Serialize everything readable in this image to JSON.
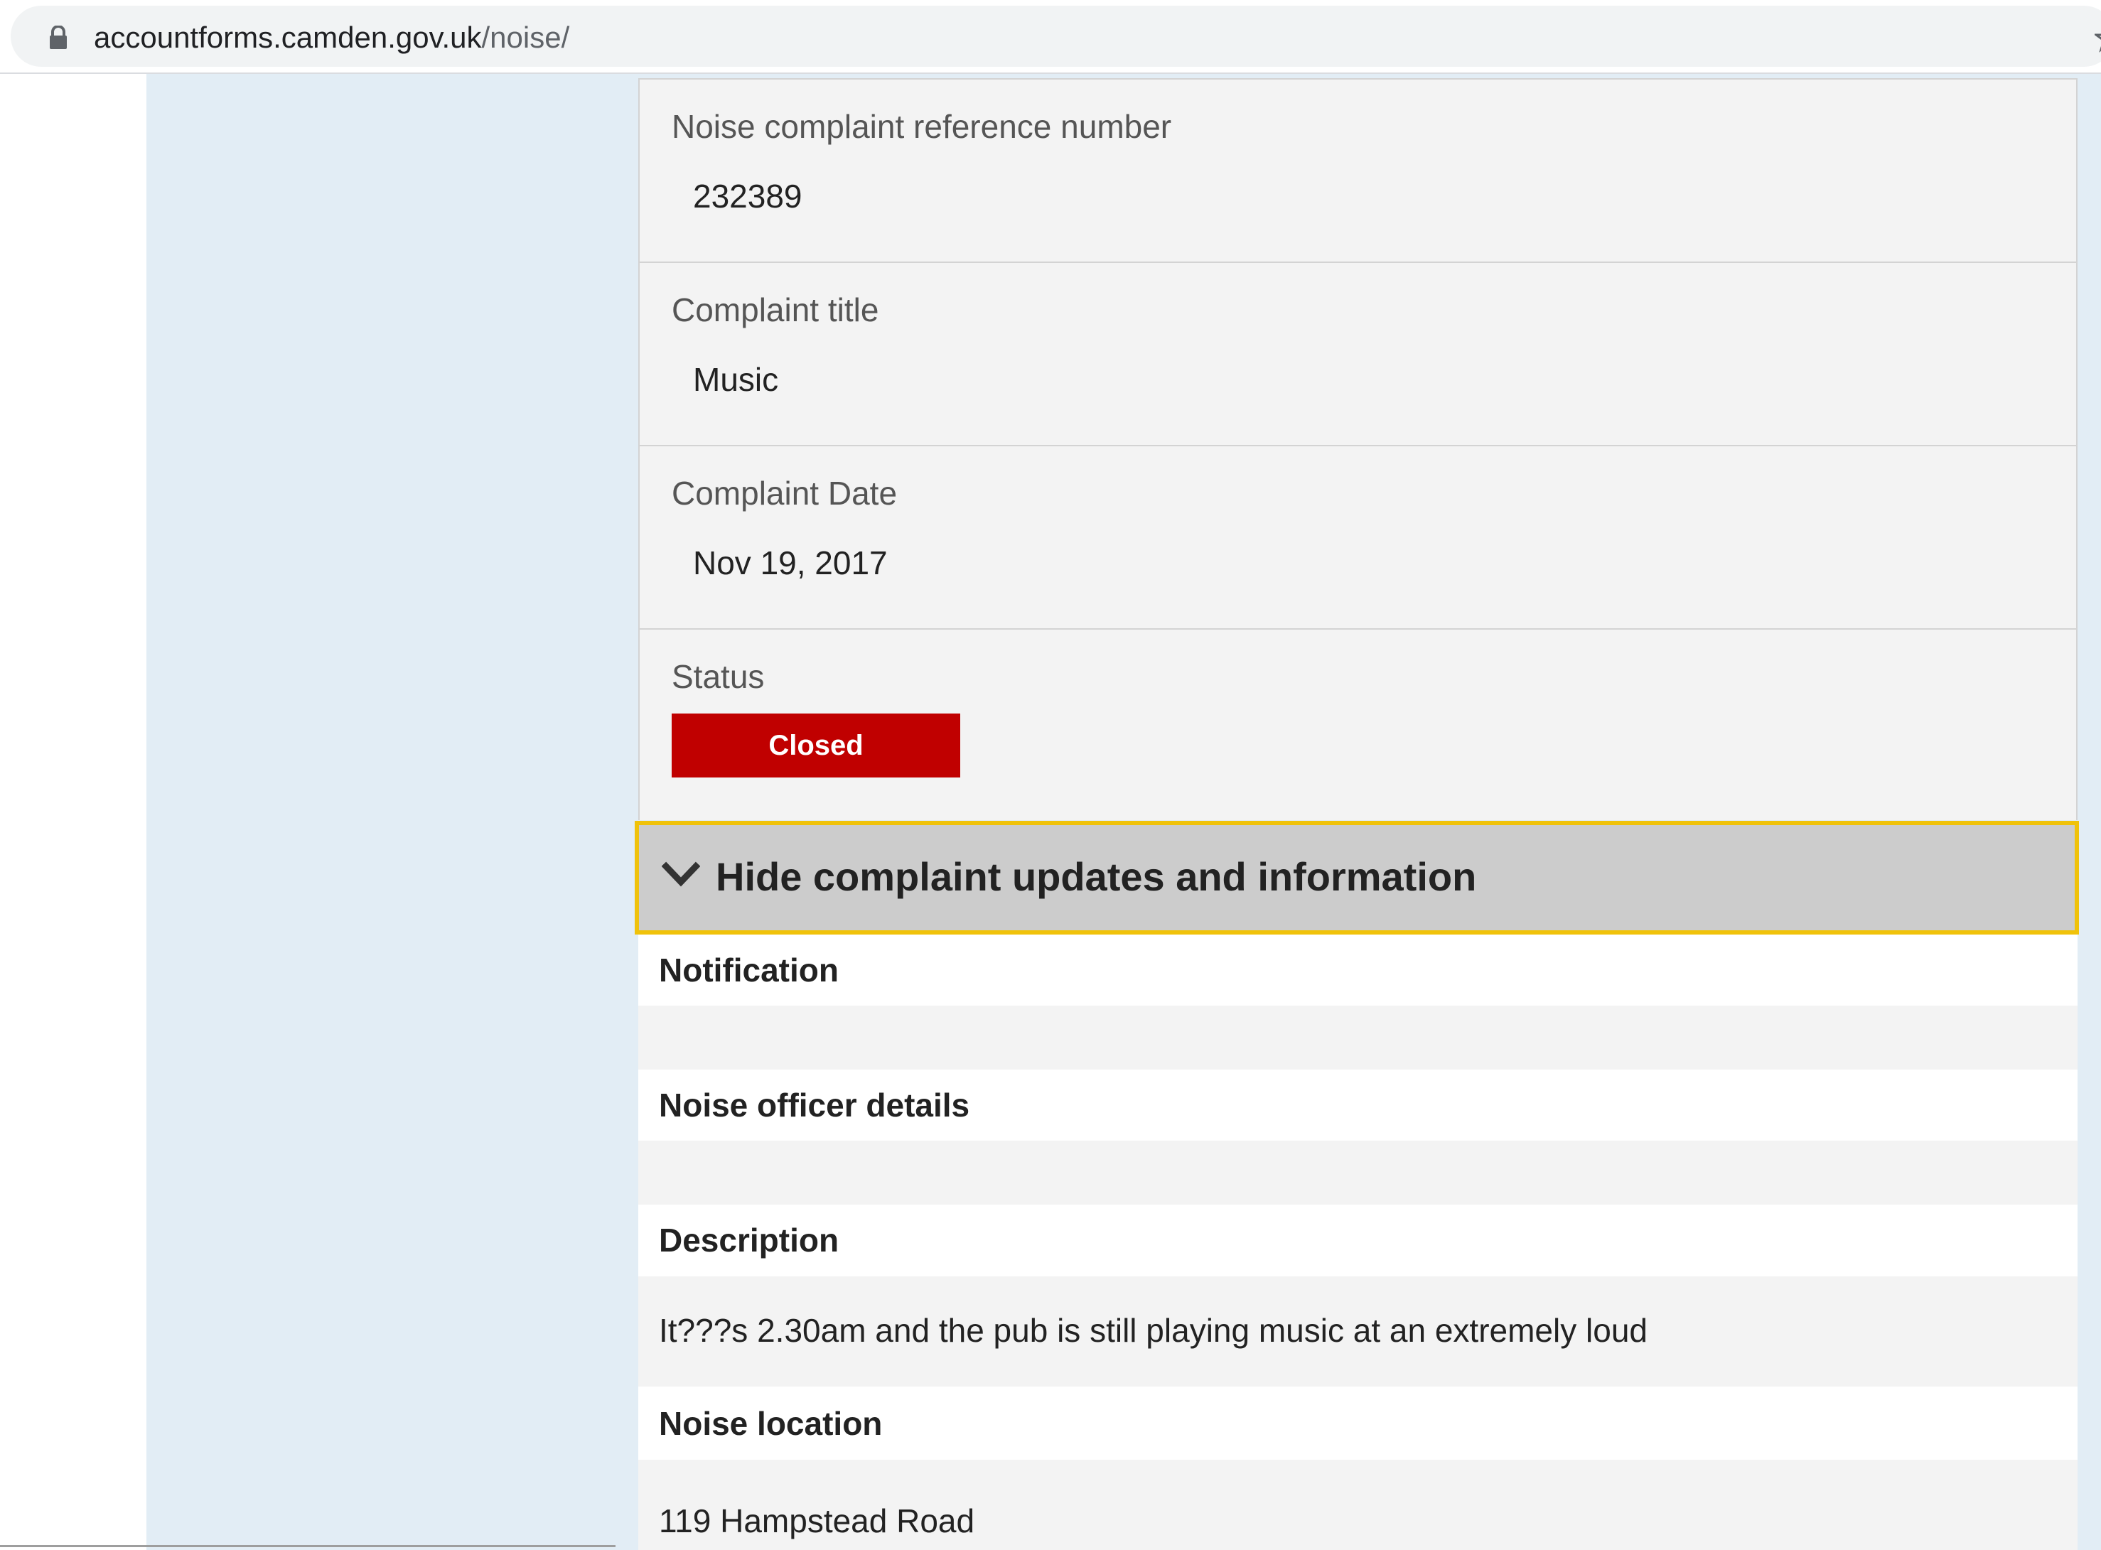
{
  "browser": {
    "url_domain": "accountforms.camden.gov.uk",
    "url_path": "/noise/"
  },
  "complaint": {
    "reference_label": "Noise complaint reference number",
    "reference_value": "232389",
    "title_label": "Complaint title",
    "title_value": "Music",
    "date_label": "Complaint Date",
    "date_value": "Nov 19, 2017",
    "status_label": "Status",
    "status_value": "Closed",
    "status_color": "#c00000"
  },
  "toggle": {
    "label": "Hide complaint updates and information",
    "focus_color": "#f0c20a"
  },
  "details": {
    "notification_heading": "Notification",
    "notification_text": "",
    "officer_heading": "Noise officer details",
    "officer_text": "",
    "description_heading": "Description",
    "description_text": "It???s 2.30am and the pub is still playing music at an extremely loud",
    "location_heading": "Noise location",
    "location_text": "119 Hampstead Road"
  },
  "icons": {
    "lock": "lock-icon",
    "star": "star-icon",
    "chevron": "chevron-down-icon"
  }
}
